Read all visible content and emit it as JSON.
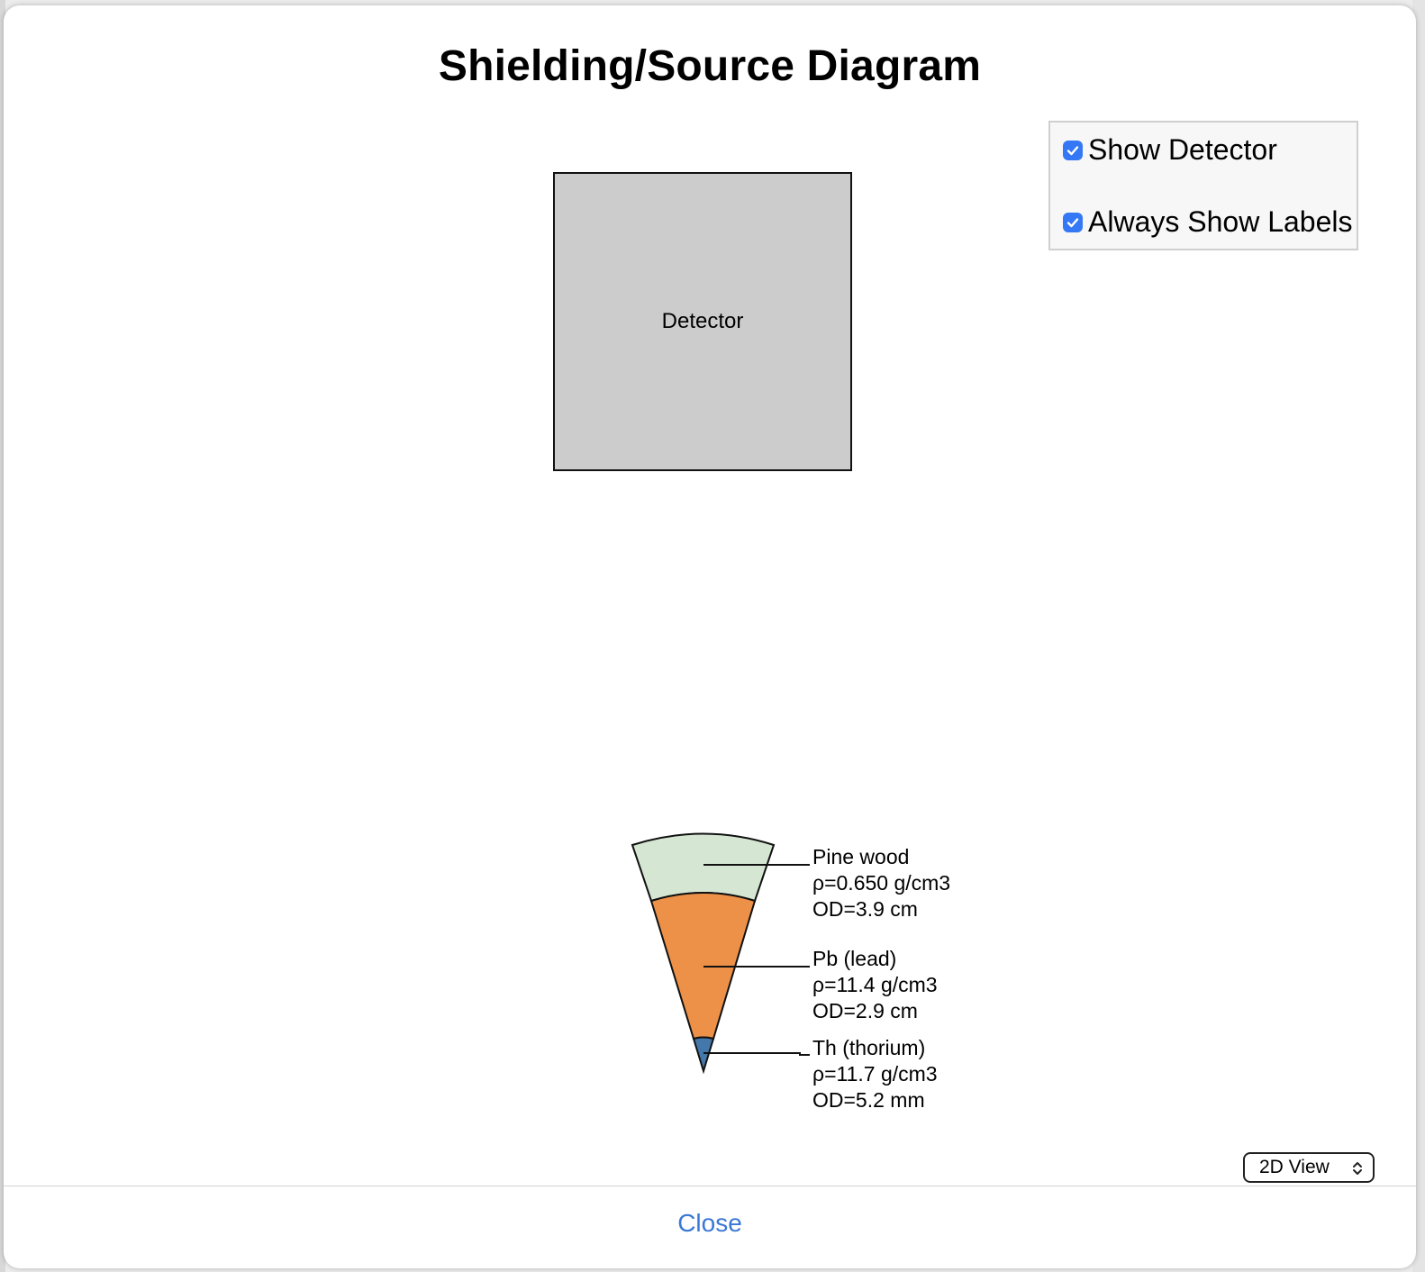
{
  "dialog": {
    "title": "Shielding/Source Diagram",
    "close_label": "Close"
  },
  "options": {
    "show_detector": {
      "label": "Show Detector",
      "checked": true
    },
    "always_show_labels": {
      "label": "Always Show Labels",
      "checked": true
    }
  },
  "detector": {
    "label": "Detector",
    "fill": "#cccccc"
  },
  "layers": [
    {
      "name": "Pine wood",
      "density": "ρ=0.650 g/cm3",
      "od": "OD=3.9 cm",
      "color": "#d5e7d3"
    },
    {
      "name": "Pb (lead)",
      "density": "ρ=11.4 g/cm3",
      "od": "OD=2.9 cm",
      "color": "#ee9148"
    },
    {
      "name": "Th (thorium)",
      "density": "ρ=11.7 g/cm3",
      "od": "OD=5.2 mm",
      "color": "#4477aa"
    }
  ],
  "view_select": {
    "value": "2D View",
    "icon": "chevron-up-down-icon"
  },
  "colors": {
    "accent": "#3478f6",
    "link": "#3a78d6"
  }
}
